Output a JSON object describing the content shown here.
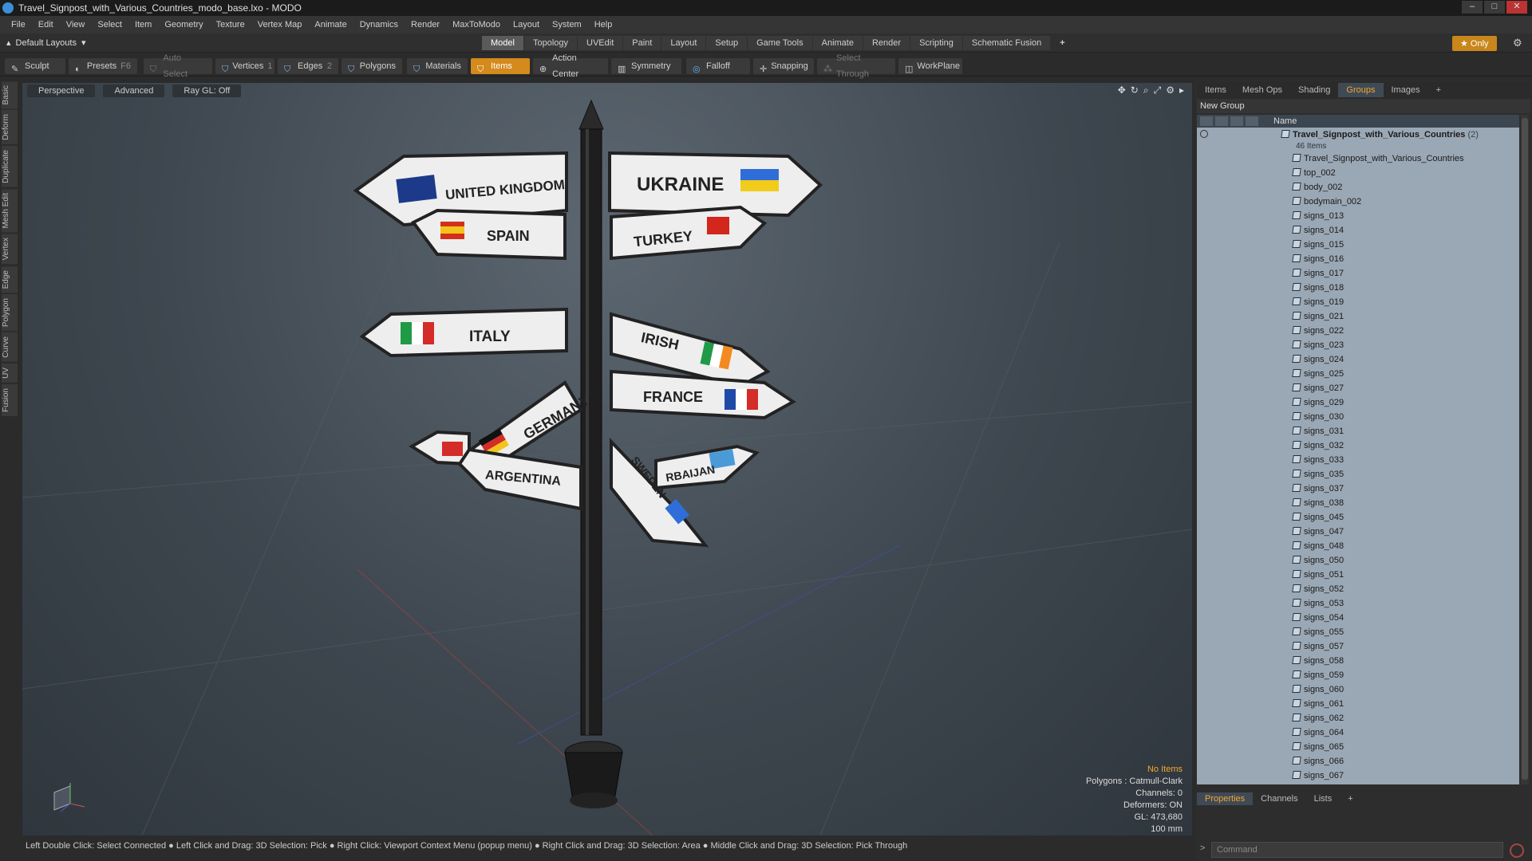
{
  "window": {
    "title": "Travel_Signpost_with_Various_Countries_modo_base.lxo - MODO",
    "controls": [
      "–",
      "□",
      "✕"
    ]
  },
  "menu": [
    "File",
    "Edit",
    "View",
    "Select",
    "Item",
    "Geometry",
    "Texture",
    "Vertex Map",
    "Animate",
    "Dynamics",
    "Render",
    "MaxToModo",
    "Layout",
    "System",
    "Help"
  ],
  "layout": {
    "selector": "Default Layouts",
    "tabs": [
      "Model",
      "Topology",
      "UVEdit",
      "Paint",
      "Layout",
      "Setup",
      "Game Tools",
      "Animate",
      "Render",
      "Scripting",
      "Schematic Fusion"
    ],
    "active_tab": "Model",
    "add": "+",
    "only": "Only"
  },
  "toolbar": {
    "sculpt": "Sculpt",
    "presets": "Presets",
    "presets_key": "F6",
    "auto_select": "Auto Select",
    "vertices": "Vertices",
    "vertices_count": "1",
    "edges": "Edges",
    "edges_count": "2",
    "polygons": "Polygons",
    "materials": "Materials",
    "items": "Items",
    "action_center": "Action Center",
    "symmetry": "Symmetry",
    "falloff": "Falloff",
    "snapping": "Snapping",
    "select_through": "Select Through",
    "workplane": "WorkPlane"
  },
  "left_tabs": [
    "Basic",
    "Deform",
    "Duplicate",
    "Mesh Edit",
    "Vertex",
    "Edge",
    "Polygon",
    "Curve",
    "UV",
    "Fusion"
  ],
  "viewport": {
    "view": "Perspective",
    "mode": "Advanced",
    "raygl": "Ray GL: Off",
    "signs": [
      "UNITED KINGDOM",
      "UKRAINE",
      "SPAIN",
      "TURKEY",
      "ITALY",
      "IRISH",
      "FRANCE",
      "GERMANY",
      "ARGENTINA",
      "SWEDEN",
      "RBAIJAN"
    ],
    "info": {
      "selection": "No Items",
      "polygons": "Polygons : Catmull-Clark",
      "channels": "Channels: 0",
      "deformers": "Deformers: ON",
      "gl": "GL: 473,680",
      "scale": "100 mm"
    }
  },
  "status_bar": "Left Double Click: Select Connected ● Left Click and Drag: 3D Selection: Pick ● Right Click: Viewport Context Menu (popup menu) ● Right Click and Drag: 3D Selection: Area ● Middle Click and Drag: 3D Selection: Pick Through",
  "right_panel": {
    "tabs": [
      "Items",
      "Mesh Ops",
      "Shading",
      "Groups",
      "Images",
      "+"
    ],
    "active_tab": "Groups",
    "new_group": "New Group",
    "column_name": "Name",
    "group": {
      "name": "Travel_Signpost_with_Various_Countries",
      "count": "(2)",
      "items_label": "46 Items"
    },
    "items": [
      "Travel_Signpost_with_Various_Countries",
      "top_002",
      "body_002",
      "bodymain_002",
      "signs_013",
      "signs_014",
      "signs_015",
      "signs_016",
      "signs_017",
      "signs_018",
      "signs_019",
      "signs_021",
      "signs_022",
      "signs_023",
      "signs_024",
      "signs_025",
      "signs_027",
      "signs_029",
      "signs_030",
      "signs_031",
      "signs_032",
      "signs_033",
      "signs_035",
      "signs_037",
      "signs_038",
      "signs_045",
      "signs_047",
      "signs_048",
      "signs_050",
      "signs_051",
      "signs_052",
      "signs_053",
      "signs_054",
      "signs_055",
      "signs_057",
      "signs_058",
      "signs_059",
      "signs_060",
      "signs_061",
      "signs_062",
      "signs_064",
      "signs_065",
      "signs_066",
      "signs_067"
    ],
    "bottom_tabs": [
      "Properties",
      "Channels",
      "Lists",
      "+"
    ],
    "bottom_active": "Properties",
    "command_placeholder": "Command",
    "command_prompt": ">"
  }
}
